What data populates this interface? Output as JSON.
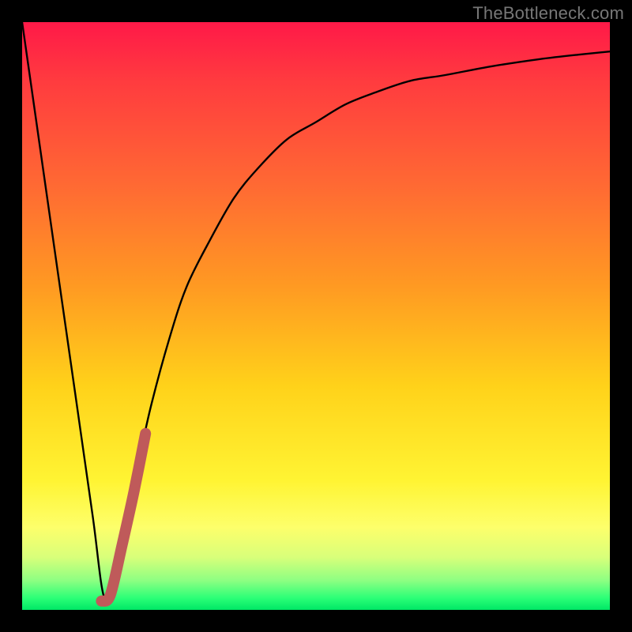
{
  "attribution": "TheBottleneck.com",
  "gradient_colors": {
    "top": "#ff1948",
    "mid_upper": "#ff9a22",
    "mid": "#fff433",
    "mid_lower": "#d9ff7a",
    "bottom": "#00e765"
  },
  "chart_data": {
    "type": "line",
    "title": "",
    "xlabel": "",
    "ylabel": "",
    "xlim": [
      0,
      100
    ],
    "ylim": [
      0,
      100
    ],
    "grid": false,
    "series": [
      {
        "name": "bottleneck-curve",
        "x": [
          0,
          3,
          6,
          9,
          12,
          14,
          16,
          18,
          20,
          22,
          25,
          28,
          32,
          36,
          40,
          45,
          50,
          55,
          60,
          66,
          72,
          80,
          88,
          95,
          100
        ],
        "y": [
          100,
          79,
          58,
          37,
          16,
          2,
          6,
          16,
          26,
          35,
          46,
          55,
          63,
          70,
          75,
          80,
          83,
          86,
          88,
          90,
          91,
          92.5,
          93.7,
          94.5,
          95
        ]
      },
      {
        "name": "highlight-segment",
        "x": [
          13.5,
          15.0,
          17.0,
          19.0,
          21.0
        ],
        "y": [
          1.5,
          2.5,
          11.0,
          20.0,
          30.0
        ]
      }
    ],
    "annotations": []
  }
}
